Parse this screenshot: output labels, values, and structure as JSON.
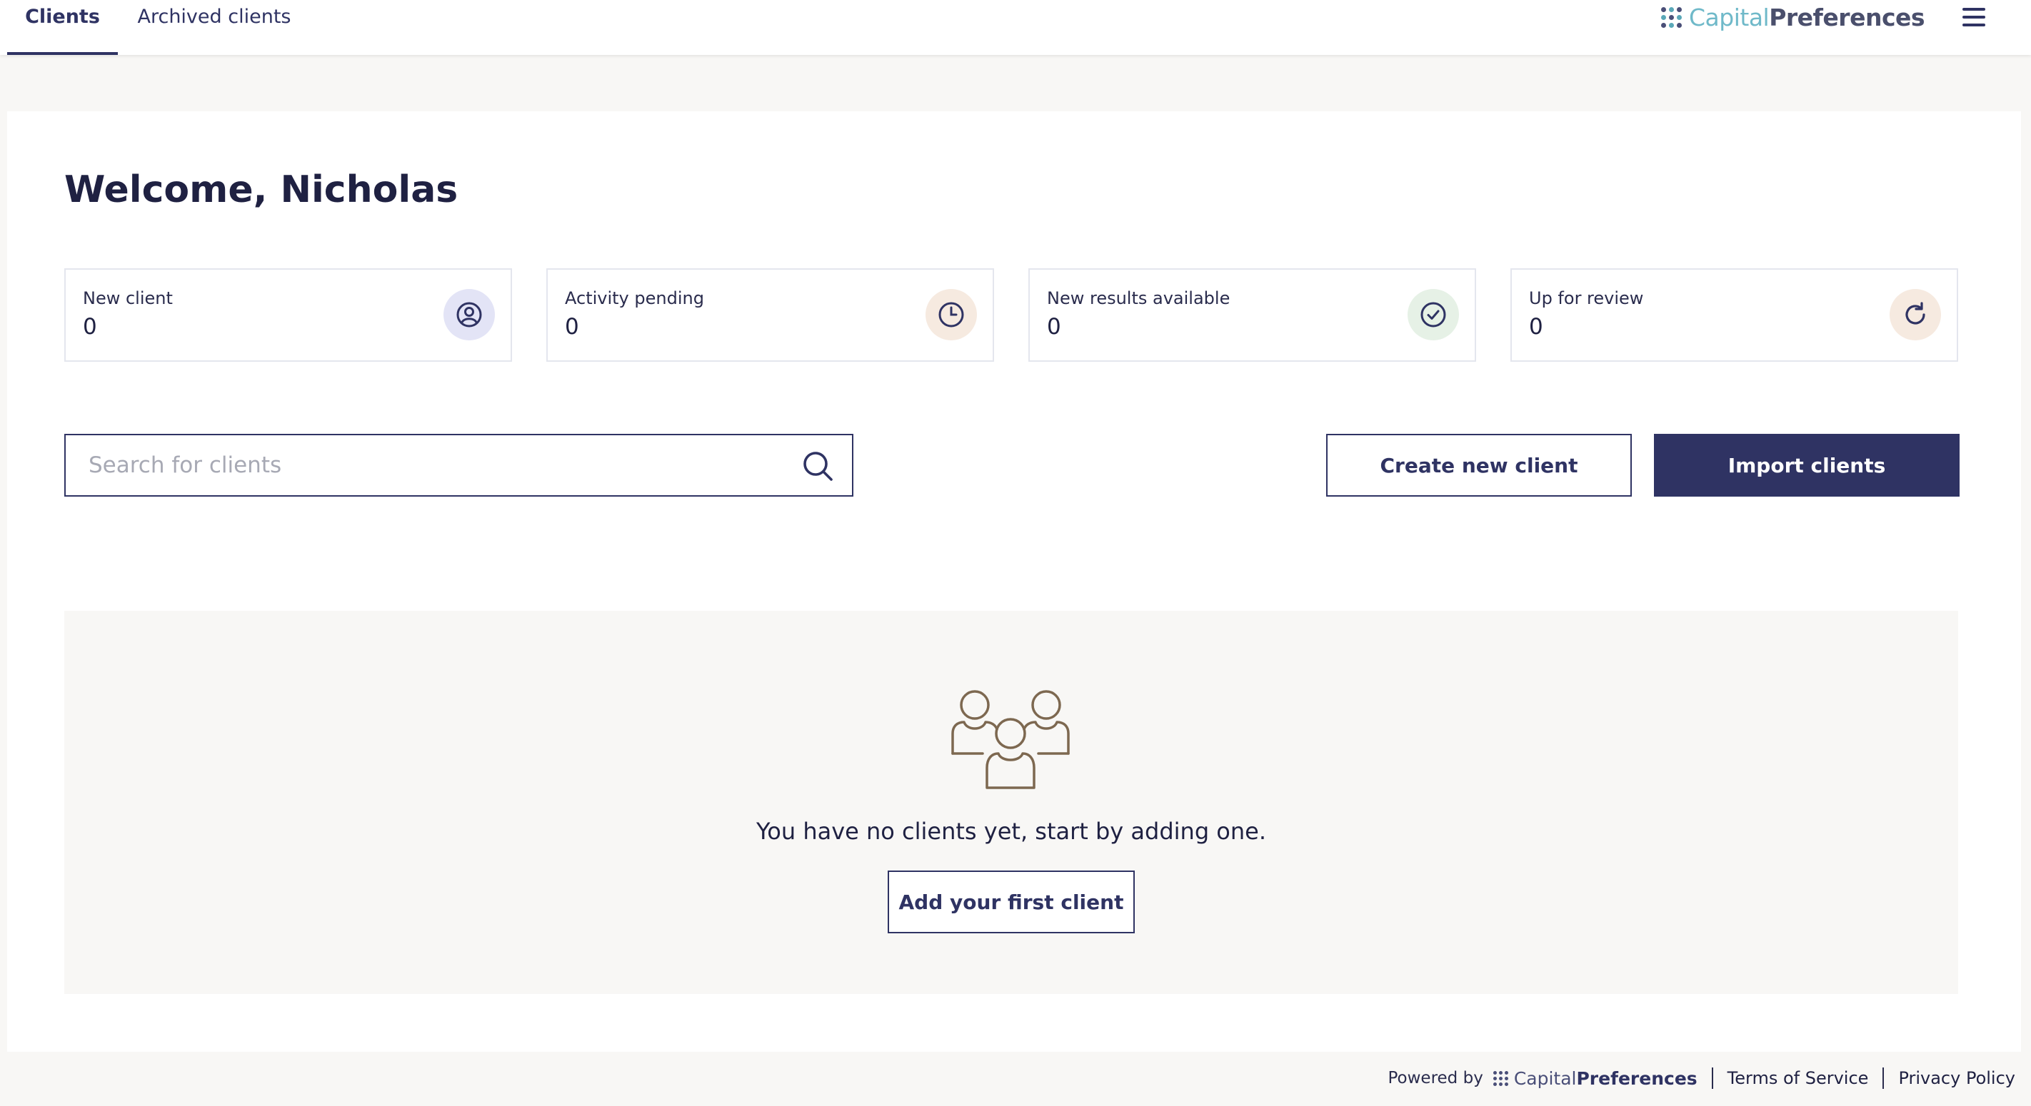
{
  "tabs": [
    {
      "label": "Clients",
      "active": true
    },
    {
      "label": "Archived clients",
      "active": false
    }
  ],
  "brand": {
    "part1": "Capital",
    "part2": "Preferences"
  },
  "welcome": "Welcome, Nicholas",
  "stats": [
    {
      "label": "New client",
      "value": "0",
      "icon": "user-circle-icon",
      "icon_bg": "#e3e4f6"
    },
    {
      "label": "Activity pending",
      "value": "0",
      "icon": "clock-icon",
      "icon_bg": "#f6eae0"
    },
    {
      "label": "New results available",
      "value": "0",
      "icon": "check-circle-icon",
      "icon_bg": "#e6f1e6"
    },
    {
      "label": "Up for review",
      "value": "0",
      "icon": "refresh-icon",
      "icon_bg": "#f6eae0"
    }
  ],
  "search": {
    "placeholder": "Search for clients",
    "value": ""
  },
  "actions": {
    "create": "Create new client",
    "import": "Import clients"
  },
  "empty_state": {
    "message": "You have no clients yet, start by adding one.",
    "button": "Add your first client",
    "icon": "users-group-icon"
  },
  "footer": {
    "powered_by": "Powered by",
    "terms": "Terms of Service",
    "privacy": "Privacy Policy"
  },
  "colors": {
    "primary": "#2f3363",
    "accent_teal": "#6fb9c9",
    "empty_icon": "#7d6850"
  }
}
